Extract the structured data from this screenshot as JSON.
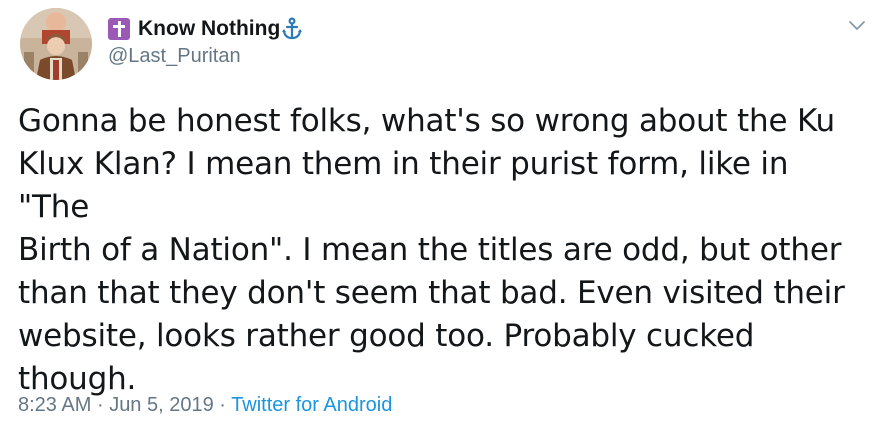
{
  "user": {
    "display_name": "Know Nothing",
    "handle": "@Last_Puritan",
    "name_emoji_prefix": "latin-cross-icon",
    "name_emoji_suffix": "anchor-icon",
    "avatar": "avatar"
  },
  "tweet": {
    "text": "Gonna be honest folks, what's so wrong about the Ku\nKlux Klan? I mean them in their purist form, like in \"The\nBirth of a Nation\". I mean the titles are odd, but other\nthan that they don't seem that bad. Even visited their\nwebsite, looks rather good too. Probably cucked\nthough."
  },
  "meta": {
    "time": "8:23 AM",
    "separator": "·",
    "date": "Jun 5, 2019",
    "source": "Twitter for Android"
  },
  "menu": {
    "icon": "chevron-down-icon"
  },
  "colors": {
    "text": "#14171a",
    "secondary": "#657786",
    "link": "#1b95e0",
    "cross_bg": "#9b59b6",
    "anchor": "#2b7bb9"
  }
}
